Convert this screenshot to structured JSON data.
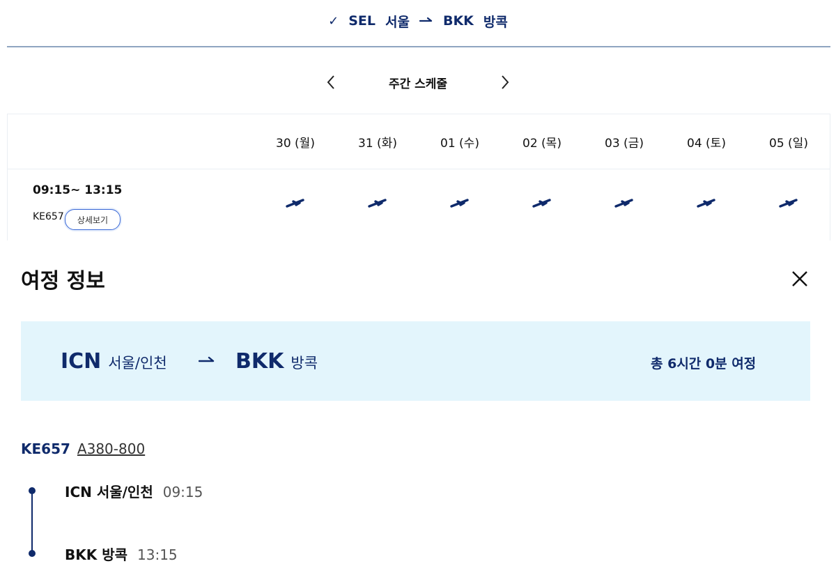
{
  "route_header": {
    "check": "✓",
    "origin_code": "SEL",
    "origin_city": "서울",
    "dest_code": "BKK",
    "dest_city": "방콕"
  },
  "week_nav": {
    "title": "주간 스케줄"
  },
  "schedule": {
    "days": [
      "30 (월)",
      "31 (화)",
      "01 (수)",
      "02 (목)",
      "03 (금)",
      "04 (토)",
      "05 (일)"
    ],
    "rows": [
      {
        "time_range": "09:15~ 13:15",
        "flight_no": "KE657",
        "detail_label": "상세보기",
        "operates": [
          true,
          true,
          true,
          true,
          true,
          true,
          true
        ]
      }
    ]
  },
  "panel": {
    "title": "여정 정보",
    "summary": {
      "origin_code": "ICN",
      "origin_city": "서울/인천",
      "dest_code": "BKK",
      "dest_city": "방콕",
      "total": "총 6시간 0분 여정"
    },
    "leg": {
      "flight_no": "KE657",
      "aircraft": "A380-800",
      "departure": {
        "name": "ICN 서울/인천",
        "time": "09:15"
      },
      "arrival": {
        "name": "BKK 방콕",
        "time": "13:15"
      }
    }
  },
  "colors": {
    "navy": "#0f2a6b",
    "summary_bg": "#e3f5fc",
    "rule": "#8fa5c0"
  }
}
